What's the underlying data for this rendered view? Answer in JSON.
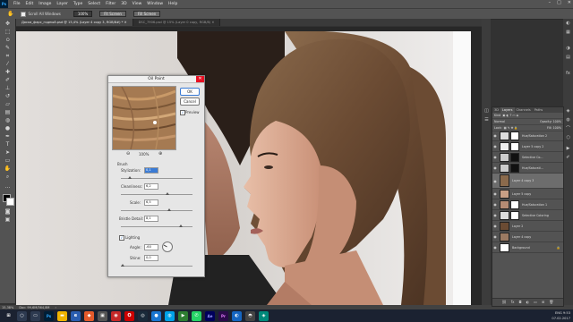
{
  "menu": {
    "logo": "Ps",
    "items": [
      "File",
      "Edit",
      "Image",
      "Layer",
      "Type",
      "Select",
      "Filter",
      "3D",
      "View",
      "Window",
      "Help"
    ]
  },
  "options_bar": {
    "scroll_all_label": "Scroll All Windows",
    "zoom_value": "100%",
    "fit_screen_label": "Fit Screen",
    "fill_screen_label": "Fill Screen"
  },
  "tabs": [
    {
      "label": "Доска_фарс_годный.psd @ 15,4% (Layer 4 copy 3, RGB/8#) *",
      "active": true
    },
    {
      "label": "DSC_7906.psd @ 15% (Layer 0 copy, RGB/8)",
      "active": false
    }
  ],
  "status_bar": {
    "zoom": "15,38%",
    "doc": "Doc: 99,6M/364,8M"
  },
  "dialog": {
    "title": "Oil Paint",
    "ok_label": "OK",
    "cancel_label": "Cancel",
    "preview_label": "Preview",
    "zoom_pct": "100%",
    "section_brush": "Brush",
    "stylization_label": "Stylization:",
    "stylization_value": "0,1",
    "stylization_pct": 0.1,
    "cleanliness_label": "Cleanliness:",
    "cleanliness_value": "6,2",
    "cleanliness_pct": 0.62,
    "scale_label": "Scale:",
    "scale_value": "6,5",
    "scale_pct": 0.65,
    "bristle_label": "Bristle Detail:",
    "bristle_value": "8,1",
    "bristle_pct": 0.81,
    "lighting_label": "Lighting",
    "angle_label": "Angle:",
    "angle_value": "-60",
    "shine_label": "Shine:",
    "shine_value": "0,0",
    "shine_pct": 0.0
  },
  "layers_panel": {
    "tabs": [
      "3D",
      "Layers",
      "Channels",
      "Paths"
    ],
    "kind_label": "Kind",
    "blend_mode": "Normal",
    "opacity": "Opacity: 100%",
    "lock_label": "Lock:",
    "fill": "Fill: 100%",
    "layers": [
      {
        "name": "Hue/Saturation 2",
        "selected": false
      },
      {
        "name": "Layer 5 copy 2",
        "selected": false
      },
      {
        "name": "Selective Co...",
        "selected": false
      },
      {
        "name": "Hue/Saturati...",
        "selected": false
      },
      {
        "name": "Layer 4 copy 3",
        "selected": true
      },
      {
        "name": "Layer 5 copy",
        "selected": false
      },
      {
        "name": "Hue/Saturation 1",
        "selected": false
      },
      {
        "name": "Selective Coloring",
        "selected": false
      },
      {
        "name": "Layer 2",
        "selected": false
      },
      {
        "name": "Layer 4 copy",
        "selected": false
      },
      {
        "name": "Background",
        "selected": false
      }
    ],
    "footer_icons": [
      "link",
      "fx",
      "mask",
      "adjust",
      "folder",
      "new",
      "trash"
    ]
  },
  "taskbar": {
    "time": "9:53",
    "date": "07.02.2017",
    "lang": "ENG"
  }
}
